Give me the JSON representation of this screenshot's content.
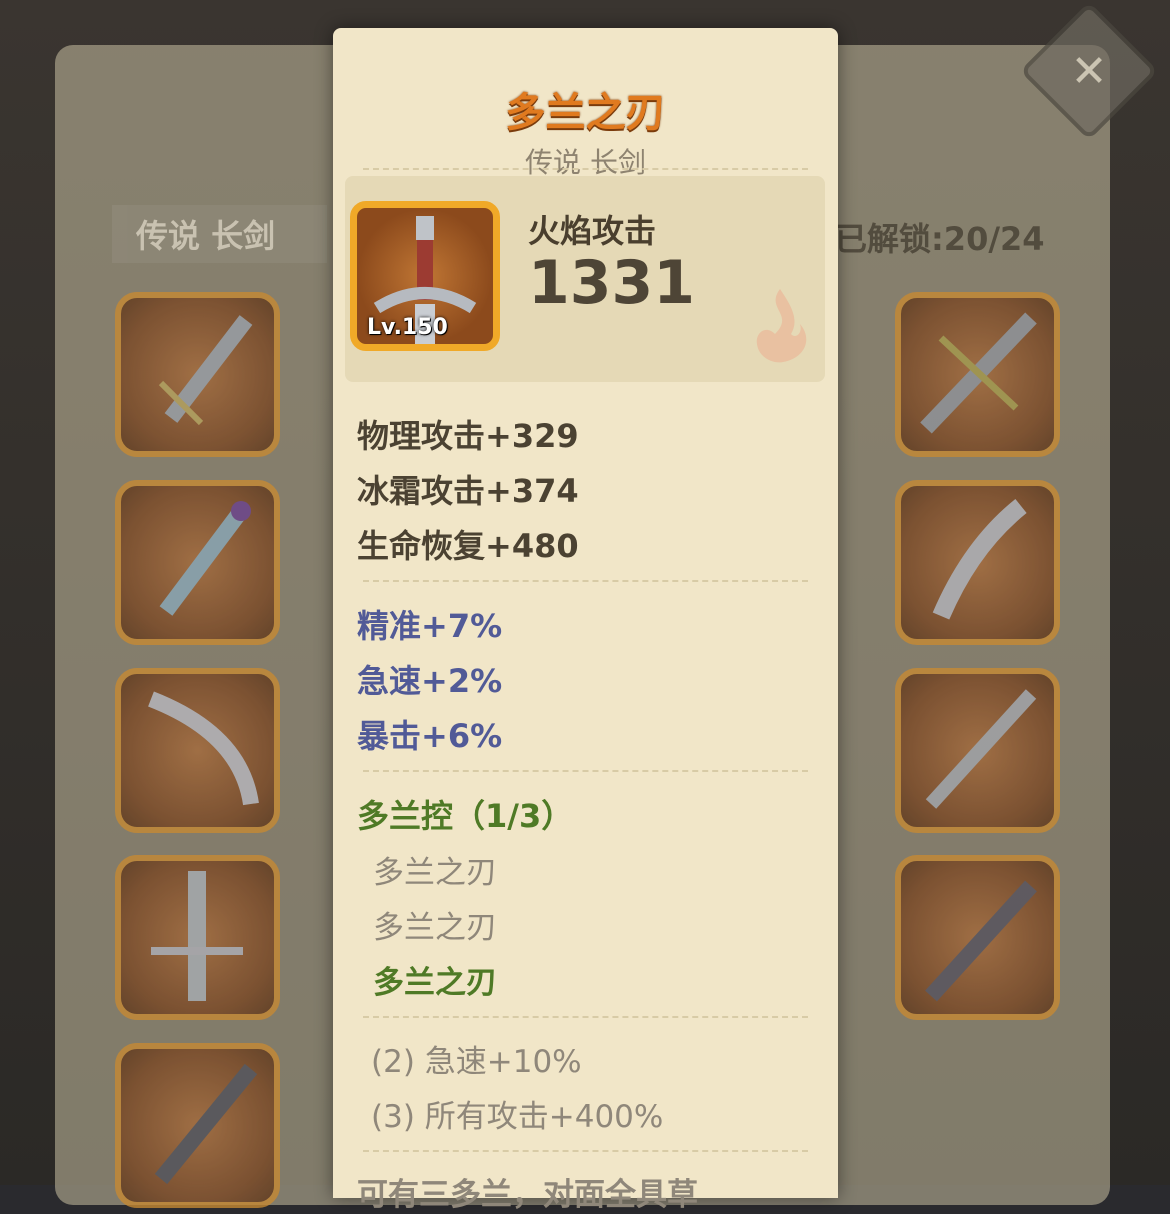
{
  "background": {
    "category_tab": "传说 长剑",
    "unlocked_text": "已解锁:20/24",
    "close_label": "✕"
  },
  "panel": {
    "title": "多兰之刃",
    "subtitle": "传说 长剑",
    "item_level": "Lv.150",
    "main_stat_label": "火焰攻击",
    "main_stat_value": "1331",
    "base_stats": [
      "物理攻击+329",
      "冰霜攻击+374",
      "生命恢复+480"
    ],
    "rare_stats": [
      "精准+7%",
      "急速+2%",
      "暴击+6%"
    ],
    "set_name": "多兰控（1/3）",
    "set_items": [
      "多兰之刃",
      "多兰之刃",
      "多兰之刃"
    ],
    "set_bonuses": [
      "(2) 急速+10%",
      "(3) 所有攻击+400%"
    ],
    "cut_text": "可有三多兰，对面全具草"
  },
  "colors": {
    "title": "#e07a1f",
    "rare_stat": "#515a97",
    "set_stat": "#4f7a26",
    "frame_gold": "#f0a928"
  }
}
